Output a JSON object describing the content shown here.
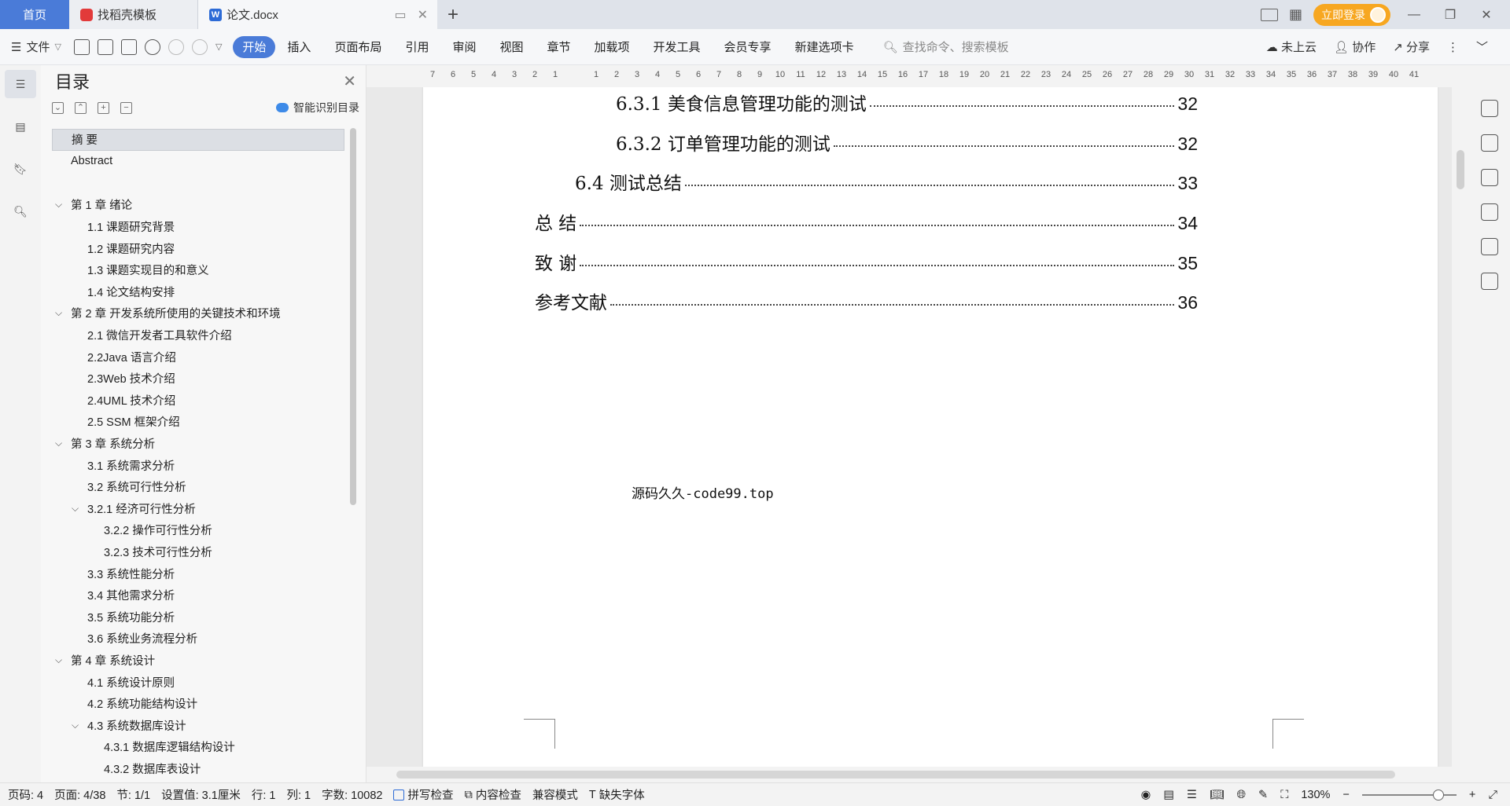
{
  "tabs": {
    "home": "首页",
    "template": "找稻壳模板",
    "document": "论文.docx"
  },
  "titlebar": {
    "login": "立即登录"
  },
  "ribbon": {
    "file_menu": "文件",
    "tabs": [
      "开始",
      "插入",
      "页面布局",
      "引用",
      "审阅",
      "视图",
      "章节",
      "加载项",
      "开发工具",
      "会员专享",
      "新建选项卡"
    ],
    "search_placeholder": "查找命令、搜索模板",
    "cloud": "未上云",
    "collab": "协作",
    "share": "分享"
  },
  "toc": {
    "title": "目录",
    "smart": "智能识别目录",
    "items": [
      {
        "label": "摘  要",
        "level": 1
      },
      {
        "label": "Abstract",
        "level": 1
      },
      {
        "label": "第 1 章  绪论",
        "level": 1
      },
      {
        "label": "1.1 课题研究背景",
        "level": 2
      },
      {
        "label": "1.2 课题研究内容",
        "level": 2
      },
      {
        "label": "1.3 课题实现目的和意义",
        "level": 2
      },
      {
        "label": "1.4 论文结构安排",
        "level": 2
      },
      {
        "label": "第 2 章  开发系统所使用的关键技术和环境",
        "level": 1
      },
      {
        "label": "2.1 微信开发者工具软件介绍",
        "level": 2
      },
      {
        "label": "2.2Java 语言介绍",
        "level": 2
      },
      {
        "label": "2.3Web 技术介绍",
        "level": 2
      },
      {
        "label": "2.4UML 技术介绍",
        "level": 2
      },
      {
        "label": "2.5 SSM 框架介绍",
        "level": 2
      },
      {
        "label": "第 3 章  系统分析",
        "level": 1
      },
      {
        "label": "3.1 系统需求分析",
        "level": 2
      },
      {
        "label": "3.2 系统可行性分析",
        "level": 2
      },
      {
        "label": "3.2.1 经济可行性分析",
        "level": 2
      },
      {
        "label": "3.2.2 操作可行性分析",
        "level": 3
      },
      {
        "label": "3.2.3 技术可行性分析",
        "level": 3
      },
      {
        "label": "3.3 系统性能分析",
        "level": 2
      },
      {
        "label": "3.4 其他需求分析",
        "level": 2
      },
      {
        "label": "3.5 系统功能分析",
        "level": 2
      },
      {
        "label": "3.6 系统业务流程分析",
        "level": 2
      },
      {
        "label": "第 4 章  系统设计",
        "level": 1
      },
      {
        "label": "4.1 系统设计原则",
        "level": 2
      },
      {
        "label": "4.2 系统功能结构设计",
        "level": 2
      },
      {
        "label": "4.3 系统数据库设计",
        "level": 2
      },
      {
        "label": "4.3.1 数据库逻辑结构设计",
        "level": 3
      },
      {
        "label": "4.3.2 数据库表设计",
        "level": 3
      }
    ]
  },
  "ruler": {
    "left_numbers": [
      "7",
      "6",
      "5",
      "4",
      "3",
      "2",
      "1"
    ],
    "right_numbers": [
      "1",
      "2",
      "3",
      "4",
      "5",
      "6",
      "7",
      "8",
      "9",
      "10",
      "11",
      "12",
      "13",
      "14",
      "15",
      "16",
      "17",
      "18",
      "19",
      "20",
      "21",
      "22",
      "23",
      "24",
      "25",
      "26",
      "27",
      "28",
      "29",
      "30",
      "31",
      "32",
      "33",
      "34",
      "35",
      "36",
      "37",
      "38",
      "39",
      "40",
      "41"
    ]
  },
  "document": {
    "lines": [
      {
        "text": "6.3.1 美食信息管理功能的测试",
        "page": "32"
      },
      {
        "text": "6.3.2 订单管理功能的测试",
        "page": "32"
      },
      {
        "text": "6.4 测试总结",
        "page": "33"
      },
      {
        "text": "总  结",
        "page": "34"
      },
      {
        "text": "致  谢",
        "page": "35"
      },
      {
        "text": "参考文献",
        "page": "36"
      }
    ],
    "watermark": "源码久久-code99.top"
  },
  "status": {
    "page_code": "页码: 4",
    "pages": "页面: 4/38",
    "section": "节: 1/1",
    "setting": "设置值: 3.1厘米",
    "row": "行: 1",
    "col": "列: 1",
    "words": "字数: 10082",
    "spell": "拼写检查",
    "content": "内容检查",
    "compat": "兼容模式",
    "missing_font": "缺失字体",
    "zoom": "130%"
  }
}
